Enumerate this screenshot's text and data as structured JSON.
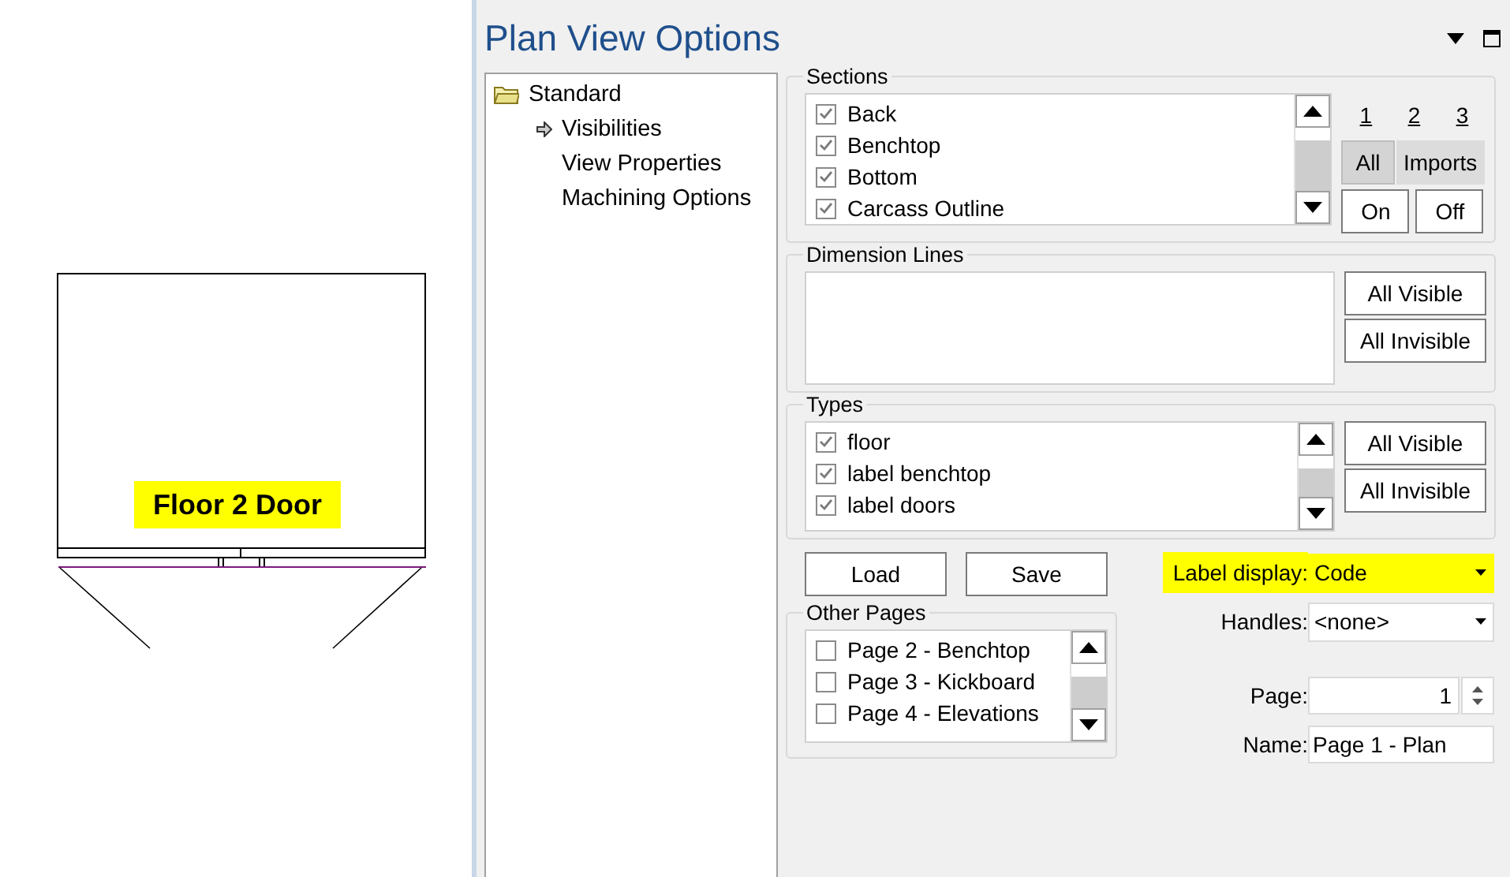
{
  "canvas": {
    "label": "Floor 2 Door"
  },
  "panel": {
    "title": "Plan View Options"
  },
  "tree": [
    {
      "label": "Standard",
      "selected": false,
      "children": [
        {
          "label": "Visibilities",
          "selected": true
        },
        {
          "label": "View Properties",
          "selected": false
        },
        {
          "label": "Machining Options",
          "selected": false
        }
      ]
    }
  ],
  "sections": {
    "title": "Sections",
    "items": [
      {
        "label": "Back",
        "checked": true
      },
      {
        "label": "Benchtop",
        "checked": true
      },
      {
        "label": "Bottom",
        "checked": true
      },
      {
        "label": "Carcass Outline",
        "checked": true
      }
    ]
  },
  "page_links": [
    "1",
    "2",
    "3"
  ],
  "filter_tabs": [
    {
      "label": "All",
      "selected": true
    },
    {
      "label": "Imports",
      "selected": false
    }
  ],
  "section_buttons": [
    "On",
    "Off"
  ],
  "dimension_lines": {
    "title": "Dimension Lines",
    "buttons": [
      "All Visible",
      "All Invisible"
    ]
  },
  "types": {
    "title": "Types",
    "items": [
      {
        "label": "floor",
        "checked": true
      },
      {
        "label": "label benchtop",
        "checked": true
      },
      {
        "label": "label doors",
        "checked": true
      }
    ],
    "buttons": [
      "All Visible",
      "All Invisible"
    ]
  },
  "file_buttons": [
    "Load",
    "Save"
  ],
  "other_pages": {
    "title": "Other Pages",
    "items": [
      {
        "label": "Page 2 - Benchtop",
        "checked": false
      },
      {
        "label": "Page 3 - Kickboard",
        "checked": false
      },
      {
        "label": "Page 4 - Elevations",
        "checked": false
      }
    ]
  },
  "fields": [
    {
      "kind": "combo",
      "label": "Label display:",
      "value": "Code",
      "highlighted": true
    },
    {
      "kind": "combo",
      "label": "Handles:",
      "value": "<none>",
      "highlighted": false
    },
    {
      "kind": "spin",
      "label": "Page:",
      "value": "1",
      "highlighted": false
    },
    {
      "kind": "text",
      "label": "Name:",
      "value": "Page 1 - Plan",
      "highlighted": false
    }
  ]
}
